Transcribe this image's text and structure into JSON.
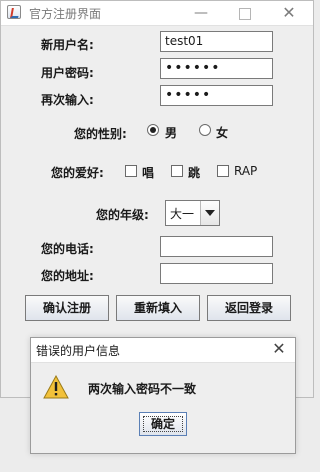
{
  "window": {
    "title": "官方注册界面",
    "controls": {
      "minimize": "—",
      "close": "✕"
    }
  },
  "form": {
    "username": {
      "label": "新用户名:",
      "value": "test01"
    },
    "password": {
      "label": "用户密码:",
      "value": "••••••"
    },
    "confirm": {
      "label": "再次输入:",
      "value": "•••••"
    },
    "gender": {
      "label": "您的性别:",
      "options": [
        "男",
        "女"
      ],
      "selected": "男"
    },
    "hobby": {
      "label": "您的爱好:",
      "options": [
        "唱",
        "跳",
        "RAP"
      ]
    },
    "grade": {
      "label": "您的年级:",
      "selected": "大一"
    },
    "phone": {
      "label": "您的电话:",
      "value": ""
    },
    "address": {
      "label": "您的地址:",
      "value": ""
    }
  },
  "buttons": {
    "confirm": "确认注册",
    "refill": "重新填入",
    "back": "返回登录"
  },
  "dialog": {
    "title": "错误的用户信息",
    "message": "两次输入密码不一致",
    "ok": "确定",
    "close": "✕",
    "icon": "warning-icon"
  }
}
